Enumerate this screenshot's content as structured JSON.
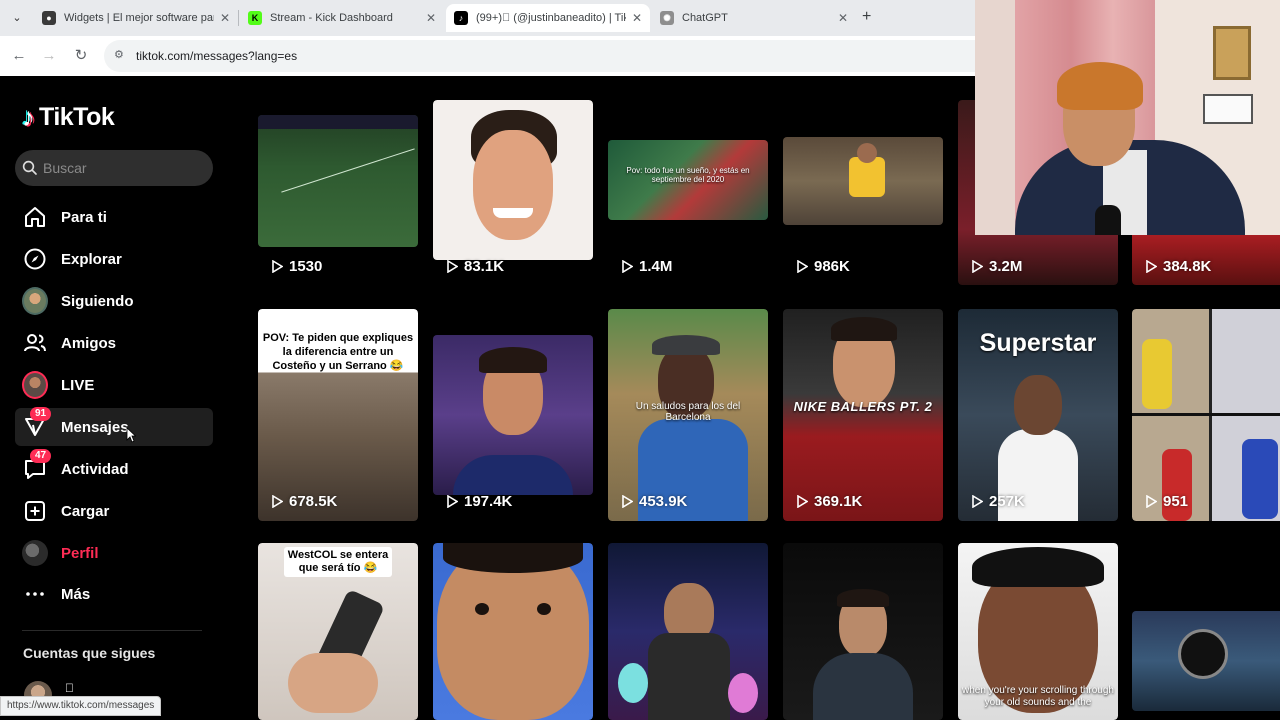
{
  "browser": {
    "tabs": [
      {
        "title": "Widgets | El mejor software par",
        "fav_color": "#3a3a3a",
        "active": false
      },
      {
        "title": "Stream - Kick Dashboard",
        "fav_color": "#53fc18",
        "active": false
      },
      {
        "title": "(99+)\u0000 (@justinbaneadito) | Tik",
        "fav_color": "#000000",
        "active": true
      },
      {
        "title": "ChatGPT",
        "fav_color": "#8e8e8e",
        "active": false
      }
    ],
    "url": "tiktok.com/messages?lang=es",
    "status_url": "https://www.tiktok.com/messages"
  },
  "sidebar": {
    "logo_text": "TikTok",
    "search_placeholder": "Buscar",
    "items": [
      {
        "label": "Para ti",
        "icon": "home-icon"
      },
      {
        "label": "Explorar",
        "icon": "compass-icon"
      },
      {
        "label": "Siguiendo",
        "icon": "following-avatar-icon"
      },
      {
        "label": "Amigos",
        "icon": "friends-icon"
      },
      {
        "label": "LIVE",
        "icon": "live-avatar-icon"
      },
      {
        "label": "Mensajes",
        "icon": "messages-icon",
        "badge": "91"
      },
      {
        "label": "Actividad",
        "icon": "activity-icon",
        "badge": "47"
      },
      {
        "label": "Cargar",
        "icon": "upload-icon"
      },
      {
        "label": "Perfil",
        "icon": "profile-avatar-icon"
      },
      {
        "label": "Más",
        "icon": "more-icon"
      }
    ],
    "following_title": "Cuentas que sigues",
    "following_glyph": "\u0000"
  },
  "grid": {
    "rows": [
      [
        {
          "views": "1530",
          "caption": ""
        },
        {
          "views": "83.1K",
          "caption": ""
        },
        {
          "views": "1.4M",
          "caption": "Pov: todo fue un sueño, y estás en septiembre del 2020"
        },
        {
          "views": "986K",
          "caption": ""
        },
        {
          "views": "3.2M",
          "caption": ""
        },
        {
          "views": "384.8K",
          "caption": ""
        }
      ],
      [
        {
          "views": "678.5K",
          "caption": "POV: Te piden que expliques la diferencia entre un Costeño y un Serrano 😂"
        },
        {
          "views": "197.4K",
          "caption": ""
        },
        {
          "views": "453.9K",
          "caption": "Un saludos para los del Barcelona"
        },
        {
          "views": "369.1K",
          "caption": "NIKE BALLERS PT. 2"
        },
        {
          "views": "257K",
          "caption": "Superstar"
        },
        {
          "views": "951",
          "caption": ""
        }
      ],
      [
        {
          "views": "",
          "caption": "WestCOL se entera que será tío 😂"
        },
        {
          "views": "",
          "caption": ""
        },
        {
          "views": "",
          "caption": ""
        },
        {
          "views": "",
          "caption": ""
        },
        {
          "views": "",
          "caption": "when you're your scrolling through your old sounds and the"
        },
        {
          "views": "",
          "caption": ""
        }
      ]
    ]
  },
  "colors": {
    "accent": "#fe2c55",
    "sidebar_bg": "#000000",
    "active_item": "#1f1f1f"
  }
}
